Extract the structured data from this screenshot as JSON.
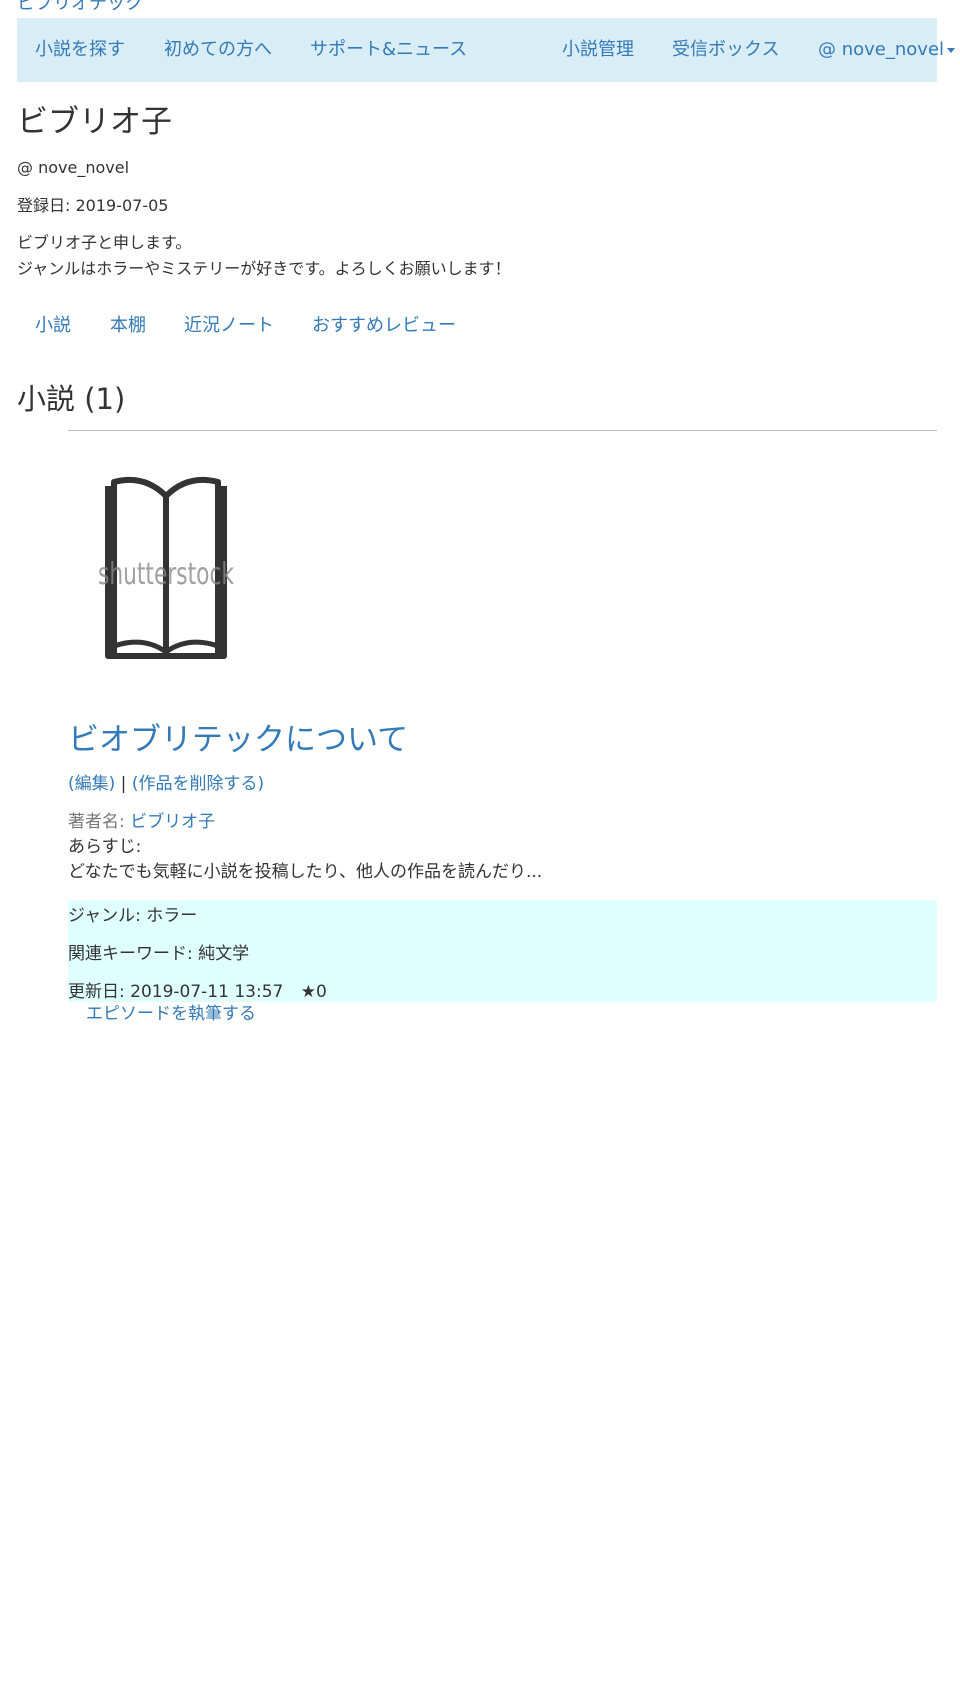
{
  "brand": "ビブリオテック",
  "navbar": {
    "find_novels": "小説を探す",
    "beginners": "初めての方へ",
    "support_news": "サポート&ニュース",
    "novel_management": "小説管理",
    "inbox": "受信ボックス",
    "user_menu": "@ nove_novel"
  },
  "profile": {
    "name": "ビブリオ子",
    "handle": "@ nove_novel",
    "registered": "登録日: 2019-07-05",
    "bio_line1": "ビブリオ子と申します。",
    "bio_line2": "ジャンルはホラーやミステリーが好きです。よろしくお願いします！"
  },
  "tabs": [
    "小説",
    "本棚",
    "近況ノート",
    "おすすめレビュー"
  ],
  "section": {
    "title": "小説 (1)"
  },
  "novel": {
    "cover_watermark": "shutterstock",
    "title": "ビオブリテックについて",
    "edit_label": "(編集)",
    "separator": "|",
    "delete_label": "(作品を削除する)",
    "author_label": "著者名:",
    "author_name": "ビブリオ子",
    "synopsis_label": "あらすじ:",
    "synopsis": "どなたでも気軽に小説を投稿したり、他人の作品を読んだり...",
    "genre": "ジャンル: ホラー",
    "keywords": "関連キーワード: 純文学",
    "updated": "更新日: 2019-07-11 13:57",
    "stars": "★0",
    "write_episode": "エピソードを執筆する"
  },
  "colors": {
    "link": "#337ab7",
    "navbar_bg": "#d9edf7",
    "info_bg": "#e0ffff",
    "text": "#333333"
  }
}
